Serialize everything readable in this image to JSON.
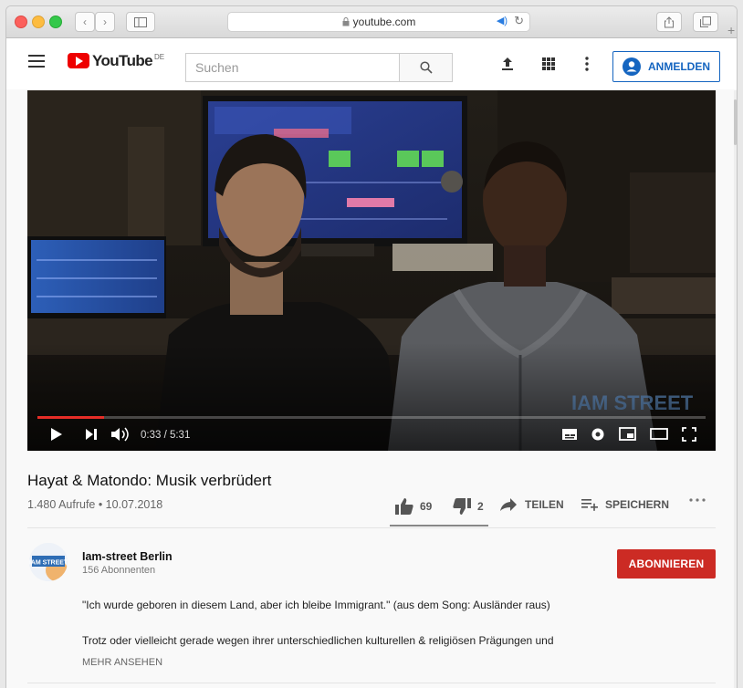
{
  "browser": {
    "url": "youtube.com"
  },
  "header": {
    "logo_text": "YouTube",
    "logo_country": "DE",
    "search_placeholder": "Suchen",
    "signin_label": "ANMELDEN"
  },
  "player": {
    "time": "0:33 / 5:31",
    "progress": 0.0997,
    "watermark": "IAM STREET"
  },
  "video": {
    "title": "Hayat & Matondo: Musik verbrüdert",
    "meta": "1.480 Aufrufe • 10.07.2018",
    "likes": "69",
    "dislikes": "2",
    "share_label": "TEILEN",
    "save_label": "SPEICHERN"
  },
  "channel": {
    "name": "Iam-street Berlin",
    "subscribers": "156 Abonnenten",
    "avatar_text": "IAM STREET",
    "subscribe_label": "ABONNIEREN"
  },
  "description": {
    "line1": "\"Ich wurde geboren in diesem Land, aber ich bleibe Immigrant.\" (aus dem Song: Ausländer raus)",
    "line2": "Trotz oder vielleicht gerade wegen ihrer unterschiedlichen kulturellen & religiösen Prägungen und",
    "more_label": "MEHR ANSEHEN"
  },
  "colors": {
    "brand_red": "#ff0000",
    "subscribe_red": "#cc2b24",
    "signin_blue": "#1565c0",
    "progress_red": "#e52d27"
  }
}
